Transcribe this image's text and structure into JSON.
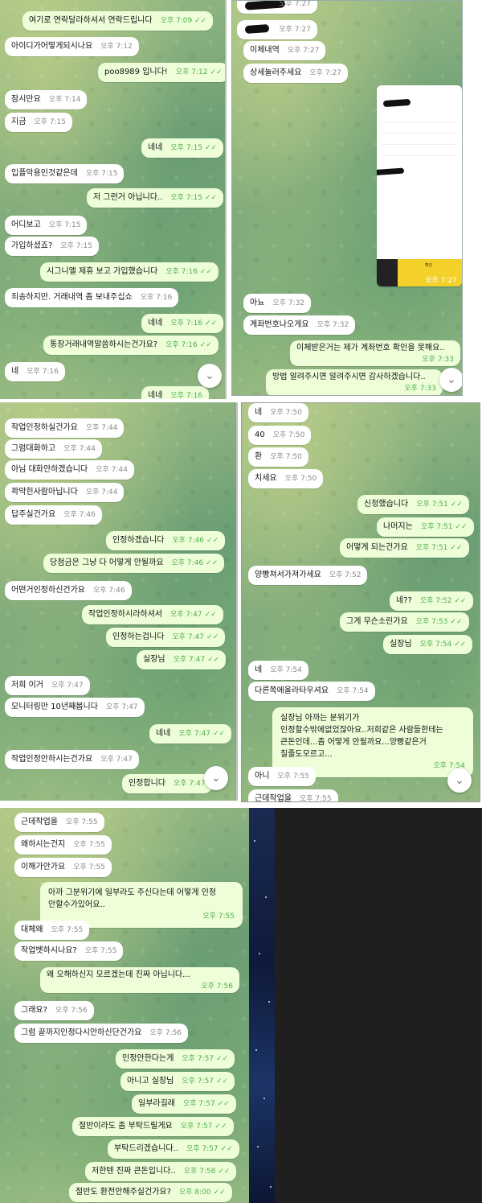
{
  "panel1": {
    "messages": [
      {
        "text": "여기로 연락달라하셔서 연락드립니다",
        "time": "오후 7:09",
        "dir": "out"
      },
      {
        "text": "아이디가어떻게되시나요",
        "time": "오후 7:12",
        "dir": "in"
      },
      {
        "text": "poo8989 입니다!",
        "time": "오후 7:12",
        "dir": "out"
      },
      {
        "text": "잠시만요",
        "time": "오후 7:14",
        "dir": "in"
      },
      {
        "text": "지금",
        "time": "오후 7:15",
        "dir": "in"
      },
      {
        "text": "네네",
        "time": "오후 7:15",
        "dir": "out"
      },
      {
        "text": "입플악용인것같은데",
        "time": "오후 7:15",
        "dir": "in"
      },
      {
        "text": "저 그런거 아닙니다..",
        "time": "오후 7:15",
        "dir": "out"
      },
      {
        "text": "어디보고",
        "time": "오후 7:15",
        "dir": "in"
      },
      {
        "text": "가입하셨죠?",
        "time": "오후 7:15",
        "dir": "in"
      },
      {
        "text": "시그니엘 제휴 보고 가입했습니다",
        "time": "오후 7:16",
        "dir": "out"
      },
      {
        "text": "죄송하지만. 거래내역 좀 보내주십쇼",
        "time": "오후 7:16",
        "dir": "in"
      },
      {
        "text": "네네",
        "time": "오후 7:16",
        "dir": "out"
      },
      {
        "text": "통장거래내역말씀하시는건가요?",
        "time": "오후 7:16",
        "dir": "out"
      },
      {
        "text": "네",
        "time": "오후 7:16",
        "dir": "in"
      },
      {
        "text": "네네",
        "time": "오후 7:16",
        "dir": "out"
      }
    ]
  },
  "panel2": {
    "messages": [
      {
        "text": "",
        "time": "오후 7:27",
        "dir": "in"
      },
      {
        "text": "",
        "time": "오후 7:27",
        "dir": "in"
      },
      {
        "text": "이체내역",
        "time": "오후 7:27",
        "dir": "in"
      },
      {
        "text": "상세눌러주세요",
        "time": "오후 7:27",
        "dir": "in"
      },
      {
        "text": "아뇨",
        "time": "오후 7:32",
        "dir": "in"
      },
      {
        "text": "계좌번호나오게요",
        "time": "오후 7:32",
        "dir": "in"
      },
      {
        "text": "이체받은거는 제가 계좌번호 확인을 못해요..",
        "time": "오후 7:33",
        "dir": "out"
      },
      {
        "text": "방법 알려주시면 알려주시면 감사하겠습니다..",
        "time": "오후 7:33",
        "dir": "out"
      }
    ],
    "image_time": "오후 7:27",
    "image_confirm": "확인"
  },
  "panel3": {
    "messages": [
      {
        "text": "작업인정하실건가요",
        "time": "오후 7:44",
        "dir": "in"
      },
      {
        "text": "그럼대화하고",
        "time": "오후 7:44",
        "dir": "in"
      },
      {
        "text": "아님 대화안하겠습니다",
        "time": "오후 7:44",
        "dir": "in"
      },
      {
        "text": "꽉막힌사람아닙니다",
        "time": "오후 7:44",
        "dir": "in"
      },
      {
        "text": "답주실건가요",
        "time": "오후 7:46",
        "dir": "in"
      },
      {
        "text": "인정하겠습니다",
        "time": "오후 7:46",
        "dir": "out"
      },
      {
        "text": "당첨금은 그냥 다 어떻게 안될까요",
        "time": "오후 7:46",
        "dir": "out"
      },
      {
        "text": "어떤거인정하신건가요",
        "time": "오후 7:46",
        "dir": "in"
      },
      {
        "text": "작업인정하시라하셔서",
        "time": "오후 7:47",
        "dir": "out"
      },
      {
        "text": "인정하는겁니다",
        "time": "오후 7:47",
        "dir": "out"
      },
      {
        "text": "실장님",
        "time": "오후 7:47",
        "dir": "out"
      },
      {
        "text": "저희 이거",
        "time": "오후 7:47",
        "dir": "in"
      },
      {
        "text": "모니터링만 10년째봅니다",
        "time": "오후 7:47",
        "dir": "in"
      },
      {
        "text": "네네",
        "time": "오후 7:47",
        "dir": "out"
      },
      {
        "text": "작업인정안하시는건가요",
        "time": "오후 7:47",
        "dir": "in"
      },
      {
        "text": "인정합니다",
        "time": "오후 7:47",
        "dir": "out"
      }
    ]
  },
  "panel4": {
    "messages": [
      {
        "text": "네",
        "time": "오후 7:50",
        "dir": "in"
      },
      {
        "text": "40",
        "time": "오후 7:50",
        "dir": "in"
      },
      {
        "text": "환",
        "time": "오후 7:50",
        "dir": "in"
      },
      {
        "text": "치세요",
        "time": "오후 7:50",
        "dir": "in"
      },
      {
        "text": "신청했습니다",
        "time": "오후 7:51",
        "dir": "out"
      },
      {
        "text": "나머지는",
        "time": "오후 7:51",
        "dir": "out"
      },
      {
        "text": "어떻게 되는건가요",
        "time": "오후 7:51",
        "dir": "out"
      },
      {
        "text": "양빵쳐서가져가세요",
        "time": "오후 7:52",
        "dir": "in"
      },
      {
        "text": "네??",
        "time": "오후 7:52",
        "dir": "out"
      },
      {
        "text": "그게 무슨소린가요",
        "time": "오후 7:53",
        "dir": "out"
      },
      {
        "text": "실장님",
        "time": "오후 7:54",
        "dir": "out"
      },
      {
        "text": "네",
        "time": "오후 7:54",
        "dir": "in"
      },
      {
        "text": "다른쪽에올라타우셔요",
        "time": "오후 7:54",
        "dir": "in"
      },
      {
        "text": "아니",
        "time": "오후 7:55",
        "dir": "in"
      },
      {
        "text": "근데작업을",
        "time": "오후 7:55",
        "dir": "in"
      }
    ],
    "long_message": {
      "lines": [
        "실장님 아까는 분위기가",
        "인정할수밖에없었잖아요..저희같은 사람들한테는",
        "큰돈인데...좀 어떻게 안될까요...양빵같은거",
        "칠줄도모르고..."
      ],
      "time": "오후 7:54"
    }
  },
  "panel5": {
    "messages": [
      {
        "text": "근데작업을",
        "time": "오후 7:55",
        "dir": "in"
      },
      {
        "text": "왜하시는건지",
        "time": "오후 7:55",
        "dir": "in"
      },
      {
        "text": "이해가안가요",
        "time": "오후 7:55",
        "dir": "in"
      },
      {
        "text": "대체왜",
        "time": "오후 7:55",
        "dir": "in"
      },
      {
        "text": "작업벳하시나요?",
        "time": "오후 7:55",
        "dir": "in"
      },
      {
        "text": "왜 오해하신지 모르겠는데 진짜 아닙니다...",
        "time": "오후 7:56",
        "dir": "out"
      },
      {
        "text": "그래요?",
        "time": "오후 7:56",
        "dir": "in"
      },
      {
        "text": "그럼 끝까지인정다시안하신단건가요",
        "time": "오후 7:56",
        "dir": "in"
      },
      {
        "text": "인정안한다는게",
        "time": "오후 7:57",
        "dir": "out"
      },
      {
        "text": "아니고 실장님",
        "time": "오후 7:57",
        "dir": "out"
      },
      {
        "text": "일부라길래",
        "time": "오후 7:57",
        "dir": "out"
      },
      {
        "text": "절반이라도 좀 부탁드릴게요",
        "time": "오후 7:57",
        "dir": "out"
      },
      {
        "text": "부탁드리겠습니다..",
        "time": "오후 7:57",
        "dir": "out"
      },
      {
        "text": "저한텐 진짜 큰돈입니다..",
        "time": "오후 7:58",
        "dir": "out"
      },
      {
        "text": "절반도 환전안해주실건가요?",
        "time": "오후 8:00",
        "dir": "out"
      }
    ],
    "long_message": {
      "lines": [
        "아까 그분위기에 일부라도 주신다는데 어떻게 인정",
        "안할수가있어요.."
      ],
      "time": "오후 7:55"
    }
  },
  "icons": {
    "check": "✓✓",
    "scroll_down": "⌄"
  },
  "colors": {
    "incoming": "#ffffff",
    "outgoing": "#eefed9",
    "time_out": "#4fae4e"
  }
}
